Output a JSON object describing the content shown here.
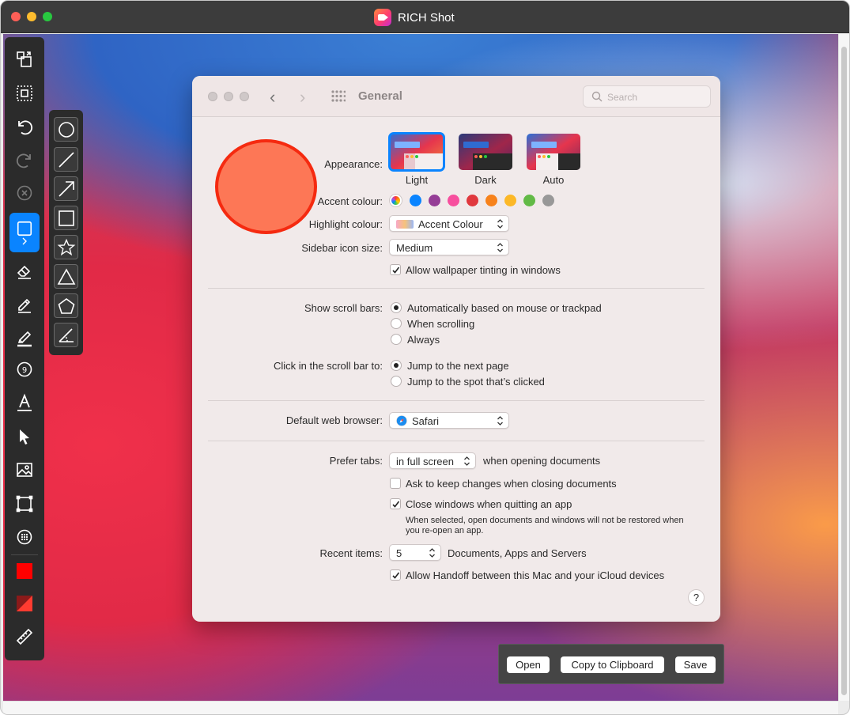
{
  "app": {
    "title": "RICH Shot",
    "colors": {
      "titlebar": "#3c3c3c",
      "accent": "#0a84ff",
      "annotation_fill": "#fd7756",
      "annotation_stroke": "#f52a10"
    }
  },
  "toolbar": {
    "tools": [
      "switch-capture-icon",
      "select-area-icon",
      "undo-icon",
      "redo-icon",
      "clear-icon",
      "rectangle-icon",
      "eraser-icon",
      "pencil-icon",
      "highlighter-icon",
      "step-counter-icon",
      "text-icon",
      "pointer-icon",
      "image-icon",
      "crop-icon",
      "blur-icon",
      "stroke-color-icon",
      "fill-color-icon",
      "ruler-icon"
    ],
    "active_tool": "rectangle-icon",
    "stroke_color": "#ff0000"
  },
  "shape_flyout": {
    "shapes": [
      "circle-icon",
      "line-icon",
      "arrow-icon",
      "rectangle-icon",
      "star-icon",
      "triangle-icon",
      "pentagon-icon",
      "angle-icon"
    ]
  },
  "prefs": {
    "title": "General",
    "search_placeholder": "Search",
    "appearance": {
      "label": "Appearance:",
      "options": [
        "Light",
        "Dark",
        "Auto"
      ],
      "selected": "Light"
    },
    "accent": {
      "label": "Accent colour:",
      "colors": [
        "#0a84ff",
        "#953d96",
        "#f74f9e",
        "#e0383e",
        "#f7821b",
        "#fcb827",
        "#62ba46",
        "#989898"
      ]
    },
    "highlight": {
      "label": "Highlight colour:",
      "value": "Accent Colour"
    },
    "sidebar_icon_size": {
      "label": "Sidebar icon size:",
      "value": "Medium"
    },
    "wallpaper_tinting": {
      "label": "Allow wallpaper tinting in windows",
      "checked": true
    },
    "scroll_bars": {
      "label": "Show scroll bars:",
      "options": [
        "Automatically based on mouse or trackpad",
        "When scrolling",
        "Always"
      ],
      "selected": 0
    },
    "click_scroll": {
      "label": "Click in the scroll bar to:",
      "options": [
        "Jump to the next page",
        "Jump to the spot that’s clicked"
      ],
      "selected": 0
    },
    "browser": {
      "label": "Default web browser:",
      "value": "Safari"
    },
    "prefer_tabs": {
      "label": "Prefer tabs:",
      "value": "in full screen",
      "suffix": "when opening documents"
    },
    "ask_keep_changes": {
      "label": "Ask to keep changes when closing documents",
      "checked": false
    },
    "close_windows": {
      "label": "Close windows when quitting an app",
      "checked": true,
      "note": "When selected, open documents and windows will not be restored when you re-open an app."
    },
    "recent_items": {
      "label": "Recent items:",
      "value": "5",
      "suffix": "Documents, Apps and Servers"
    },
    "handoff": {
      "label": "Allow Handoff between this Mac and your iCloud devices",
      "checked": true
    },
    "help": "?"
  },
  "actions": {
    "open": "Open",
    "copy": "Copy to Clipboard",
    "save": "Save"
  }
}
